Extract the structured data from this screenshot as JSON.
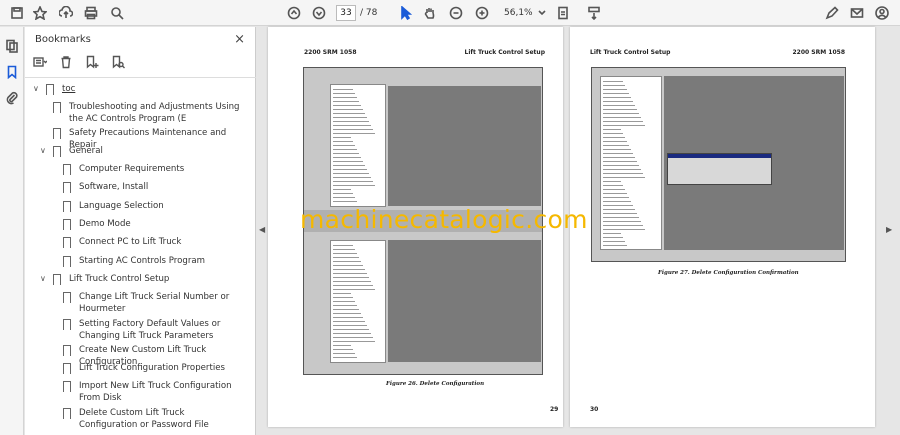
{
  "toolbar": {
    "page_current": "33",
    "page_total": "/ 78",
    "zoom": "56,1%",
    "icons": [
      "save-icon",
      "bookmark-star-icon",
      "upload-icon",
      "print-icon",
      "zoom-search-icon",
      "page-up-icon",
      "page-down-icon",
      "select-arrow-icon",
      "hand-icon",
      "zoom-out-icon",
      "zoom-in-icon",
      "fit-page-icon",
      "scroll-mode-icon",
      "sign-icon",
      "mail-icon",
      "account-icon"
    ]
  },
  "panel": {
    "title": "Bookmarks",
    "close": "×"
  },
  "bookmarks": [
    {
      "label": "toc",
      "level": 0,
      "expanded": true,
      "underline": true
    },
    {
      "label": "Troubleshooting and Adjustments Using the AC Controls Program (E",
      "level": 1
    },
    {
      "label": "Safety Precautions Maintenance and Repair",
      "level": 1
    },
    {
      "label": "General",
      "level": 1,
      "expanded": true
    },
    {
      "label": "Computer Requirements",
      "level": 2
    },
    {
      "label": "Software, Install",
      "level": 2
    },
    {
      "label": "Language Selection",
      "level": 2
    },
    {
      "label": "Demo Mode",
      "level": 2
    },
    {
      "label": "Connect PC to Lift Truck",
      "level": 2
    },
    {
      "label": "Starting AC Controls Program",
      "level": 2
    },
    {
      "label": "Lift Truck Control Setup",
      "level": 1,
      "expanded": true
    },
    {
      "label": "Change Lift Truck Serial Number or Hourmeter",
      "level": 2
    },
    {
      "label": "Setting Factory Default Values or Changing Lift Truck Parameters",
      "level": 2
    },
    {
      "label": "Create New Custom Lift Truck Configuration",
      "level": 2
    },
    {
      "label": "Lift Truck Configuration Properties",
      "level": 2
    },
    {
      "label": "Import New Lift Truck Configuration From Disk",
      "level": 2
    },
    {
      "label": "Delete Custom Lift Truck Configuration or Password File",
      "level": 2
    }
  ],
  "page_left": {
    "header_left": "2200 SRM 1058",
    "header_right": "Lift Truck Control Setup",
    "caption": "Figure 26. Delete Configuration",
    "page_number": "29"
  },
  "page_right": {
    "header_left": "Lift Truck Control Setup",
    "header_right": "2200 SRM 1058",
    "caption": "Figure 27. Delete Configuration Confirmation",
    "page_number": "30"
  },
  "watermark": "machinecatalogic.com"
}
